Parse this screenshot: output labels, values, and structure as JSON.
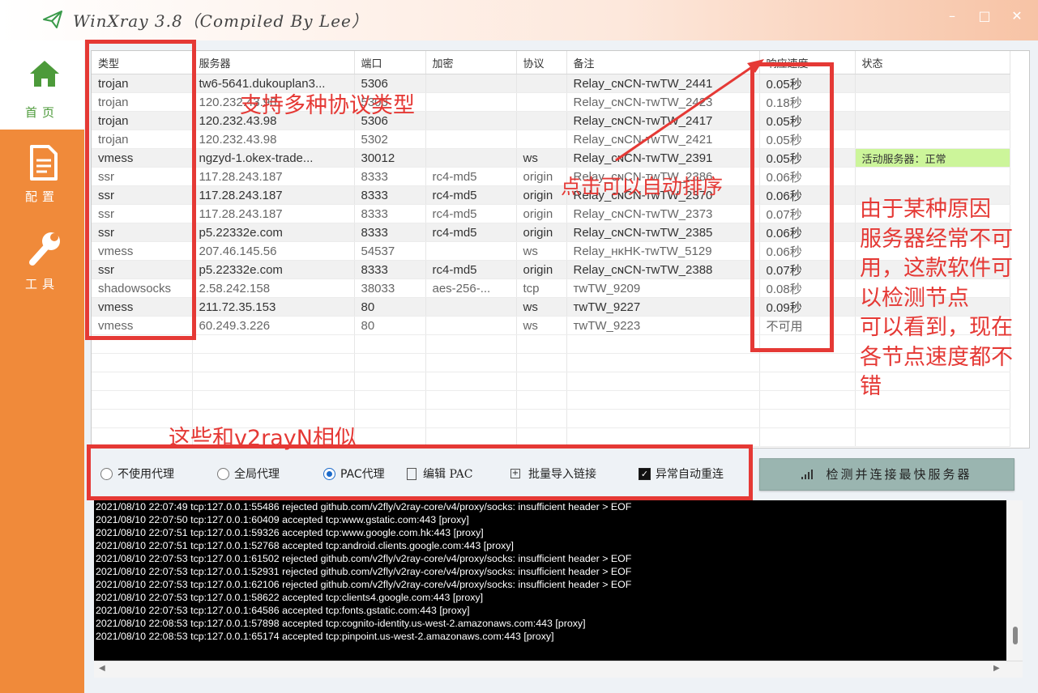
{
  "window": {
    "title": "WinXray 3.8（Compiled By Lee）",
    "minimize": "–",
    "maximize": "□",
    "close": "✕"
  },
  "sidebar": {
    "items": [
      {
        "label": "首页",
        "icon": "home-icon",
        "active": true
      },
      {
        "label": "配置",
        "icon": "document-icon",
        "active": false
      },
      {
        "label": "工具",
        "icon": "wrench-icon",
        "active": false
      }
    ]
  },
  "table": {
    "headers": [
      "类型",
      "服务器",
      "端口",
      "加密",
      "协议",
      "备注",
      "响应速度",
      "状态"
    ],
    "rows": [
      [
        "trojan",
        "tw6-5641.dukouplan3...",
        "5306",
        "",
        "",
        "Relay_ᴄɴCN-ᴛᴡTW_2441",
        "0.05秒",
        ""
      ],
      [
        "trojan",
        "120.232.43.98",
        "5303",
        "",
        "",
        "Relay_ᴄɴCN-ᴛᴡTW_2423",
        "0.18秒",
        ""
      ],
      [
        "trojan",
        "120.232.43.98",
        "5306",
        "",
        "",
        "Relay_ᴄɴCN-ᴛᴡTW_2417",
        "0.05秒",
        ""
      ],
      [
        "trojan",
        "120.232.43.98",
        "5302",
        "",
        "",
        "Relay_ᴄɴCN-ᴛᴡTW_2421",
        "0.05秒",
        ""
      ],
      [
        "vmess",
        "ngzyd-1.okex-trade...",
        "30012",
        "",
        "ws",
        "Relay_ᴄɴCN-ᴛᴡTW_2391",
        "0.05秒",
        "活动服务器：正常"
      ],
      [
        "ssr",
        "117.28.243.187",
        "8333",
        "rc4-md5",
        "origin",
        "Relay_ᴄɴCN-ᴛᴡTW_2386",
        "0.06秒",
        ""
      ],
      [
        "ssr",
        "117.28.243.187",
        "8333",
        "rc4-md5",
        "origin",
        "Relay_ᴄɴCN-ᴛᴡTW_2370",
        "0.06秒",
        ""
      ],
      [
        "ssr",
        "117.28.243.187",
        "8333",
        "rc4-md5",
        "origin",
        "Relay_ᴄɴCN-ᴛᴡTW_2373",
        "0.07秒",
        ""
      ],
      [
        "ssr",
        "p5.22332e.com",
        "8333",
        "rc4-md5",
        "origin",
        "Relay_ᴄɴCN-ᴛᴡTW_2385",
        "0.06秒",
        ""
      ],
      [
        "vmess",
        "207.46.145.56",
        "54537",
        "",
        "ws",
        "Relay_ʜᴋHK-ᴛᴡTW_5129",
        "0.06秒",
        ""
      ],
      [
        "ssr",
        "p5.22332e.com",
        "8333",
        "rc4-md5",
        "origin",
        "Relay_ᴄɴCN-ᴛᴡTW_2388",
        "0.07秒",
        ""
      ],
      [
        "shadowsocks",
        "2.58.242.158",
        "38033",
        "aes-256-...",
        "tcp",
        "ᴛᴡTW_9209",
        "0.08秒",
        ""
      ],
      [
        "vmess",
        "211.72.35.153",
        "80",
        "",
        "ws",
        "ᴛᴡTW_9227",
        "0.09秒",
        ""
      ],
      [
        "vmess",
        "60.249.3.226",
        "80",
        "",
        "ws",
        "ᴛᴡTW_9223",
        "不可用",
        ""
      ]
    ]
  },
  "options": {
    "no_proxy": "不使用代理",
    "global_proxy": "全局代理",
    "pac_proxy": "PAC代理",
    "edit_pac": "编辑 PAC",
    "batch_import": "批量导入链接",
    "auto_reconnect": "异常自动重连",
    "selected_mode": "PAC代理",
    "check_connect_button": "检测并连接最快服务器"
  },
  "log": [
    "2021/08/10 22:07:49 tcp:127.0.0.1:55486 rejected  github.com/v2fly/v2ray-core/v4/proxy/socks: insufficient header > EOF",
    "2021/08/10 22:07:50 tcp:127.0.0.1:60409 accepted tcp:www.gstatic.com:443 [proxy]",
    "2021/08/10 22:07:51 tcp:127.0.0.1:59326 accepted tcp:www.google.com.hk:443 [proxy]",
    "2021/08/10 22:07:51 tcp:127.0.0.1:52768 accepted tcp:android.clients.google.com:443 [proxy]",
    "2021/08/10 22:07:53 tcp:127.0.0.1:61502 rejected  github.com/v2fly/v2ray-core/v4/proxy/socks: insufficient header > EOF",
    "2021/08/10 22:07:53 tcp:127.0.0.1:52931 rejected  github.com/v2fly/v2ray-core/v4/proxy/socks: insufficient header > EOF",
    "2021/08/10 22:07:53 tcp:127.0.0.1:62106 rejected  github.com/v2fly/v2ray-core/v4/proxy/socks: insufficient header > EOF",
    "2021/08/10 22:07:53 tcp:127.0.0.1:58622 accepted tcp:clients4.google.com:443 [proxy]",
    "2021/08/10 22:07:53 tcp:127.0.0.1:64586 accepted tcp:fonts.gstatic.com:443 [proxy]",
    "2021/08/10 22:08:53 tcp:127.0.0.1:57898 accepted tcp:cognito-identity.us-west-2.amazonaws.com:443 [proxy]",
    "2021/08/10 22:08:53 tcp:127.0.0.1:65174 accepted tcp:pinpoint.us-west-2.amazonaws.com:443 [proxy]"
  ],
  "annotations": {
    "protocols": "支持多种协议类型",
    "sort": "点击可以自动排序",
    "reason_lines": [
      "由于某种原因",
      "服务器经常不可",
      "用，这款软件可",
      "以检测节点",
      "可以看到，现在",
      "各节点速度都不",
      "错"
    ],
    "similar": "这些和v2rayN相似"
  },
  "colors": {
    "accent_orange": "#f08a3a",
    "home_green": "#4c9a3a",
    "active_status": "#ccf59a",
    "annotation_red": "#e53935",
    "button": "#9ab5b0"
  }
}
